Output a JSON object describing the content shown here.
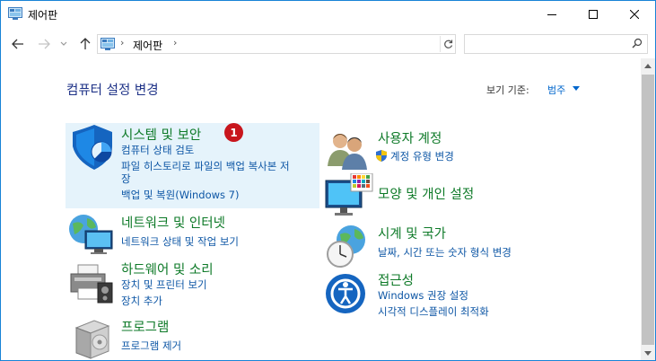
{
  "window": {
    "title": "제어판",
    "accent": "#1883d7"
  },
  "controls": {
    "minimize": "minimize-icon",
    "maximize": "maximize-icon",
    "close": "close-icon"
  },
  "address": {
    "path": "제어판",
    "search_placeholder": ""
  },
  "main": {
    "title": "컴퓨터 설정 변경",
    "view_by_label": "보기 기준:",
    "view_by_value": "범주"
  },
  "categories": [
    {
      "id": "system-security",
      "title": "시스템 및 보안",
      "badge": "1",
      "links": [
        "컴퓨터 상태 검토",
        "파일 히스토리로 파일의 백업 복사본 저",
        "장",
        "백업 및 복원(Windows 7)"
      ],
      "icon": "shield-icon"
    },
    {
      "id": "network",
      "title": "네트워크 및 인터넷",
      "links": [
        "네트워크 상태 및 작업 보기"
      ],
      "icon": "network-globe-icon"
    },
    {
      "id": "hardware",
      "title": "하드웨어 및 소리",
      "links": [
        "장치 및 프린터 보기",
        "장치 추가"
      ],
      "icon": "printer-speaker-icon"
    },
    {
      "id": "programs",
      "title": "프로그램",
      "links": [
        "프로그램 제거"
      ],
      "icon": "program-box-icon"
    },
    {
      "id": "user-accounts",
      "title": "사용자 계정",
      "links": [
        "계정 유형 변경"
      ],
      "icon": "users-icon"
    },
    {
      "id": "appearance",
      "title": "모양 및 개인 설정",
      "links": [],
      "icon": "monitor-palette-icon"
    },
    {
      "id": "clock",
      "title": "시계 및 국가",
      "links": [
        "날짜, 시간 또는 숫자 형식 변경"
      ],
      "icon": "clock-globe-icon"
    },
    {
      "id": "ease-of-access",
      "title": "접근성",
      "links": [
        "Windows 권장 설정",
        "시각적 디스플레이 최적화"
      ],
      "icon": "ease-of-access-icon"
    }
  ],
  "colors": {
    "link": "#0d56a5",
    "category_title": "#0e7a28",
    "page_title": "#1e3287",
    "highlight": "#e5f3fb",
    "badge": "#c8161d"
  }
}
